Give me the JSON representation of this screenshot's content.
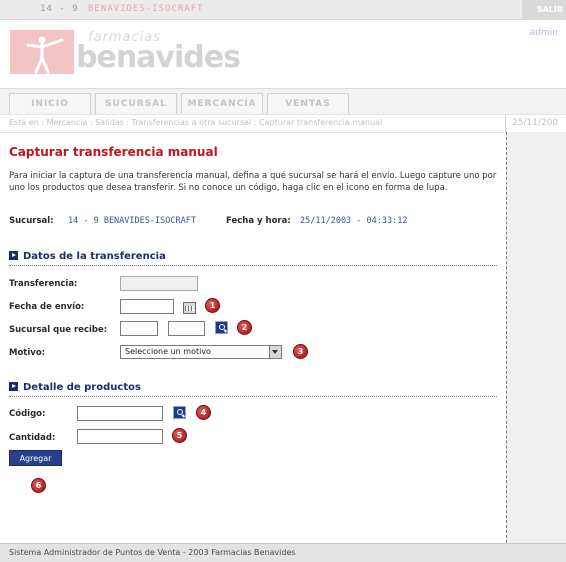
{
  "topbar": {
    "store_code": "14 - 9",
    "store_name": "BENAVIDES-ISOCRAFT",
    "logout": "SALIR"
  },
  "header": {
    "logo_top": "farmacias",
    "logo_main": "benavides",
    "user": "admin"
  },
  "nav": {
    "tabs": [
      "INICIO",
      "SUCURSAL",
      "MERCANCÍA",
      "VENTAS"
    ]
  },
  "breadcrumb": "Está en : Mercancía : Salidas : Transferencias a otra sucursal : Capturar transferencia manual",
  "date_short": "25/11/200",
  "page": {
    "title": "Capturar transferencia manual",
    "intro": "Para iniciar la captura de una transferencia manual, defina a qué sucursal se hará el envío. Luego capture uno por uno los productos que desea transferir. Si no conoce un código, haga clic en el icono en forma de lupa.",
    "sucursal_label": "Sucursal:",
    "sucursal_value": "14 - 9  BENAVIDES-ISOCRAFT",
    "fecha_label": "Fecha y hora:",
    "fecha_value": "25/11/2003 - 04:33:12"
  },
  "section1": {
    "title": "Datos de la transferencia",
    "transferencia_label": "Transferencia:",
    "fecha_envio_label": "Fecha de envío:",
    "sucursal_recibe_label": "Sucursal que recibe:",
    "motivo_label": "Motivo:",
    "motivo_value": "Seleccione un motivo"
  },
  "section2": {
    "title": "Detalle de productos",
    "codigo_label": "Código:",
    "cantidad_label": "Cantidad:",
    "agregar": "Agregar"
  },
  "markers": [
    "1",
    "2",
    "3",
    "4",
    "5",
    "6"
  ],
  "footer": "Sistema Administrador de Puntos de Venta - 2003 Farmacias Benavides",
  "colors": {
    "title_red": "#c0141e",
    "section_blue": "#1f2a6e",
    "button_blue": "#2a3f8c",
    "marker_red": "#9e1010"
  }
}
